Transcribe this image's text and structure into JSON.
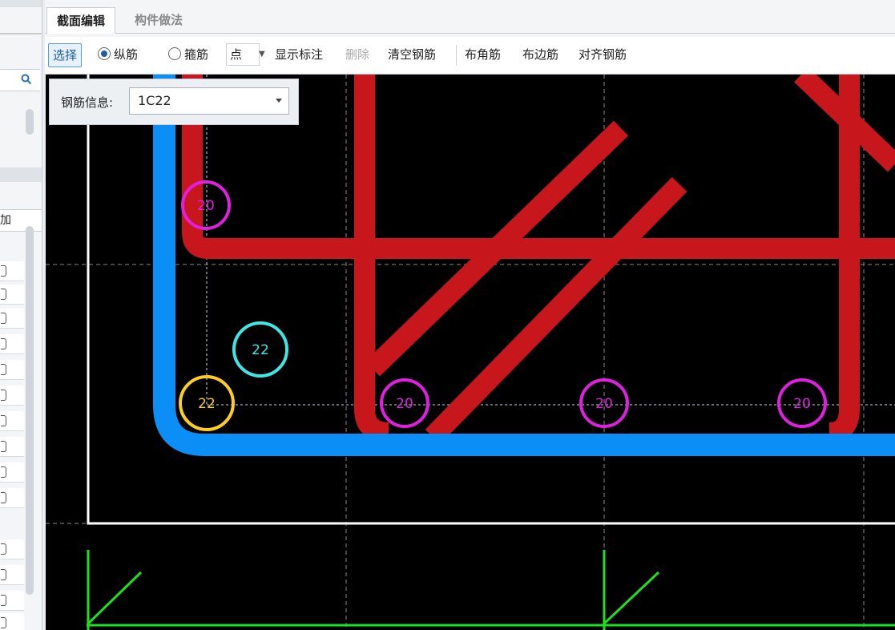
{
  "tabs": [
    {
      "label": "截面编辑",
      "active": true
    },
    {
      "label": "构件做法",
      "active": false
    }
  ],
  "toolbar": {
    "select": "选择",
    "longitudinal": "纵筋",
    "stirrup": "箍筋",
    "point": "点",
    "show_annotation": "显示标注",
    "delete": "删除",
    "clear_rebar": "清空钢筋",
    "corner_rebar": "布角筋",
    "edge_rebar": "布边筋",
    "align_rebar": "对齐钢筋",
    "mode": "longitudinal"
  },
  "rebar_info": {
    "label": "钢筋信息:",
    "value": "1C22"
  },
  "left_panel": {
    "header_fragment": "加"
  },
  "canvas": {
    "markers": [
      {
        "label": "20",
        "color": "#e020e0"
      },
      {
        "label": "22",
        "color": "#3ee6e6"
      },
      {
        "label": "22",
        "color": "#ffcc22"
      },
      {
        "label": "20",
        "color": "#e020e0"
      },
      {
        "label": "20",
        "color": "#e020e0"
      },
      {
        "label": "20",
        "color": "#e020e0"
      }
    ],
    "colors": {
      "stirrup": "#0b8ef6",
      "tie_bars": "#c8161d",
      "section_border": "#ffffff",
      "axis": "#1fe01f",
      "grid": "#8a8a8a"
    }
  }
}
